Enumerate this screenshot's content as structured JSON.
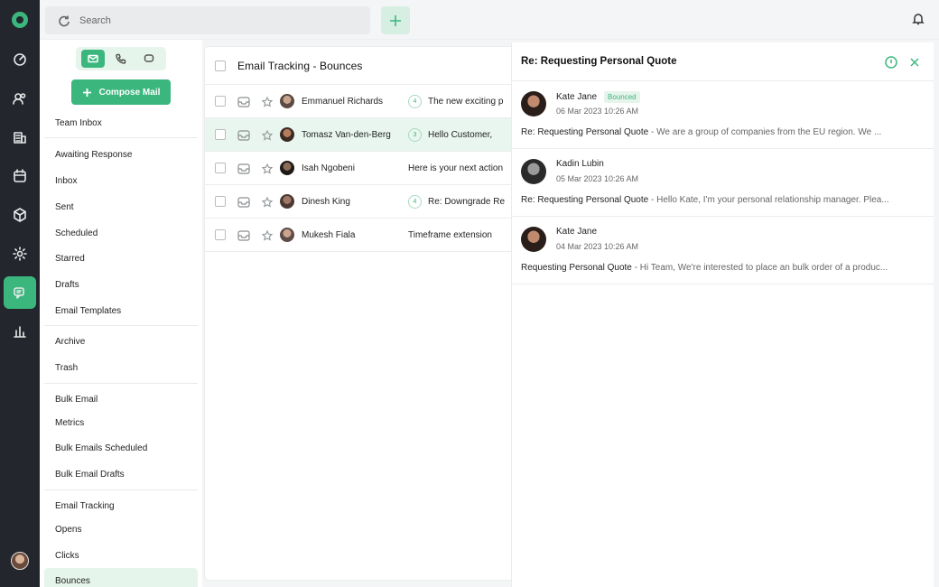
{
  "search": {
    "placeholder": "Search"
  },
  "sidebar": {
    "compose_label": "Compose Mail",
    "items": [
      {
        "label": "Team Inbox"
      },
      {
        "label": "Awaiting Response"
      },
      {
        "label": "Inbox"
      },
      {
        "label": "Sent"
      },
      {
        "label": "Scheduled"
      },
      {
        "label": "Starred"
      },
      {
        "label": "Drafts"
      },
      {
        "label": "Email Templates"
      },
      {
        "label": "Archive"
      },
      {
        "label": "Trash"
      },
      {
        "label": "Bulk Email"
      },
      {
        "label": "Metrics"
      },
      {
        "label": "Bulk Emails Scheduled"
      },
      {
        "label": "Bulk Email Drafts"
      },
      {
        "label": "Email Tracking"
      },
      {
        "label": "Opens"
      },
      {
        "label": "Clicks"
      },
      {
        "label": "Bounces"
      }
    ]
  },
  "list": {
    "title": "Email Tracking - Bounces",
    "rows": [
      {
        "sender": "Emmanuel Richards",
        "count": "4",
        "subject": "The new exciting p"
      },
      {
        "sender": "Tomasz Van-den-Berg",
        "count": "3",
        "subject": "Hello Customer,"
      },
      {
        "sender": "Isah Ngobeni",
        "count": "",
        "subject": "Here is your next action"
      },
      {
        "sender": "Dinesh King",
        "count": "4",
        "subject": "Re: Downgrade Re"
      },
      {
        "sender": "Mukesh Fiala",
        "count": "",
        "subject": "Timeframe extension"
      }
    ]
  },
  "thread": {
    "title": "Re: Requesting Personal Quote",
    "messages": [
      {
        "name": "Kate Jane",
        "badge": "Bounced",
        "date": "06 Mar 2023 10:26 AM",
        "subject": "Re: Requesting Personal Quote",
        "sep": " - ",
        "preview": "We are a group of companies from the EU region. We ..."
      },
      {
        "name": "Kadin Lubin",
        "badge": "",
        "date": "05 Mar 2023 10:26 AM",
        "subject": "Re: Requesting Personal Quote",
        "sep": " - ",
        "preview": "Hello Kate, I'm your personal relationship manager. Plea..."
      },
      {
        "name": "Kate Jane",
        "badge": "",
        "date": "04 Mar 2023 10:26 AM",
        "subject": "Requesting Personal Quote",
        "sep": " - ",
        "preview": "Hi Team, We're interested to place an bulk order of a produc..."
      }
    ]
  },
  "colors": {
    "accent": "#3bb77e",
    "rail": "#23262c",
    "accent_soft": "#e6f5ec"
  }
}
